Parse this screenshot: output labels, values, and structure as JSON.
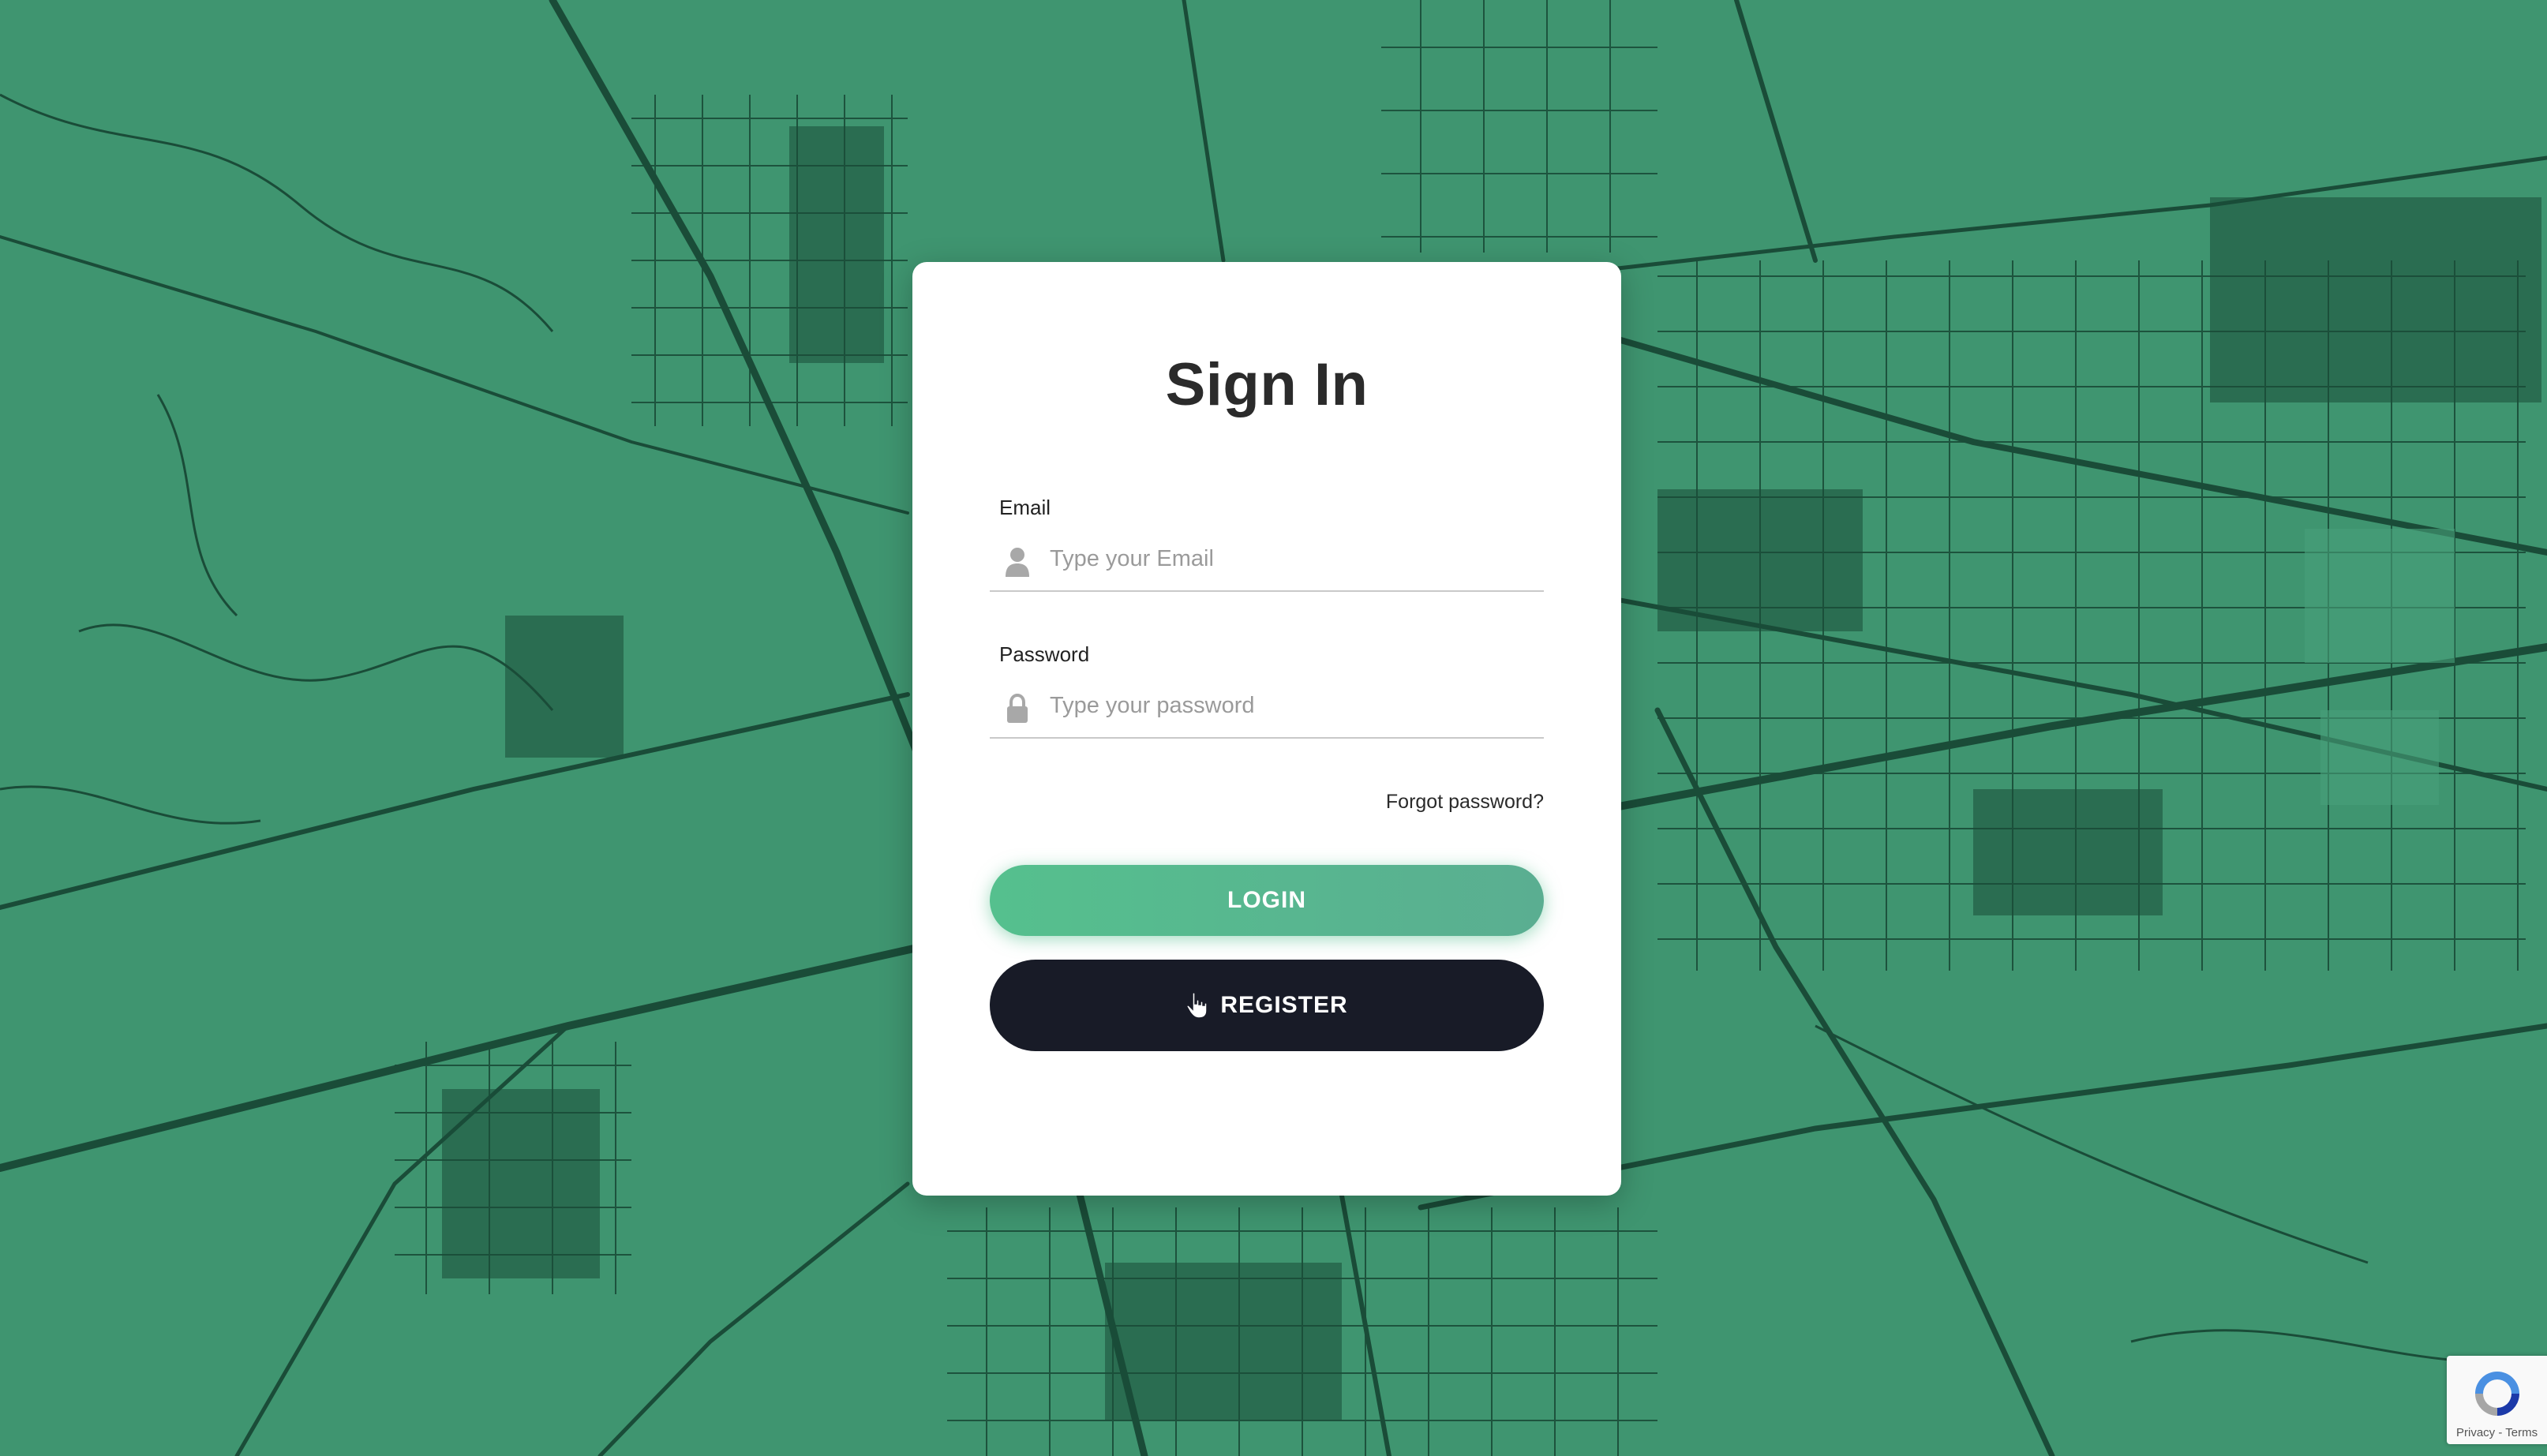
{
  "colors": {
    "background": "#3f9570",
    "map_lines": "#1a4c38",
    "card": "#ffffff",
    "login_start": "#55c08e",
    "login_end": "#5aae91",
    "register": "#181b27"
  },
  "form": {
    "title": "Sign In",
    "email": {
      "label": "Email",
      "placeholder": "Type your Email",
      "value": "",
      "icon": "user-icon"
    },
    "password": {
      "label": "Password",
      "placeholder": "Type your password",
      "value": "",
      "icon": "lock-icon"
    },
    "forgot_label": "Forgot password?",
    "login_label": "LOGIN",
    "register_label": "REGISTER",
    "register_icon": "pointer-hand-icon"
  },
  "recaptcha": {
    "links": "Privacy - Terms",
    "icon": "recaptcha-logo-icon"
  }
}
